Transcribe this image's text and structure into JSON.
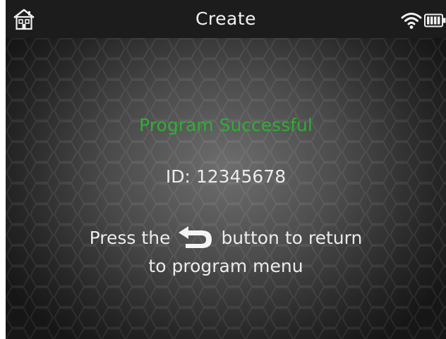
{
  "header": {
    "title": "Create",
    "left_icon": "home-icon",
    "status_icons": [
      "wifi-icon",
      "battery-icon"
    ]
  },
  "main": {
    "status_message": "Program Successful",
    "device_id": "ID: 12345678",
    "instruction": {
      "before_icon": "Press the",
      "icon": "back-arrow-icon",
      "after_icon": "button to return",
      "line2": "to program menu"
    }
  },
  "colors": {
    "status": "#2fae34",
    "text": "#ececec",
    "header_bg": "#1c1c1c"
  }
}
